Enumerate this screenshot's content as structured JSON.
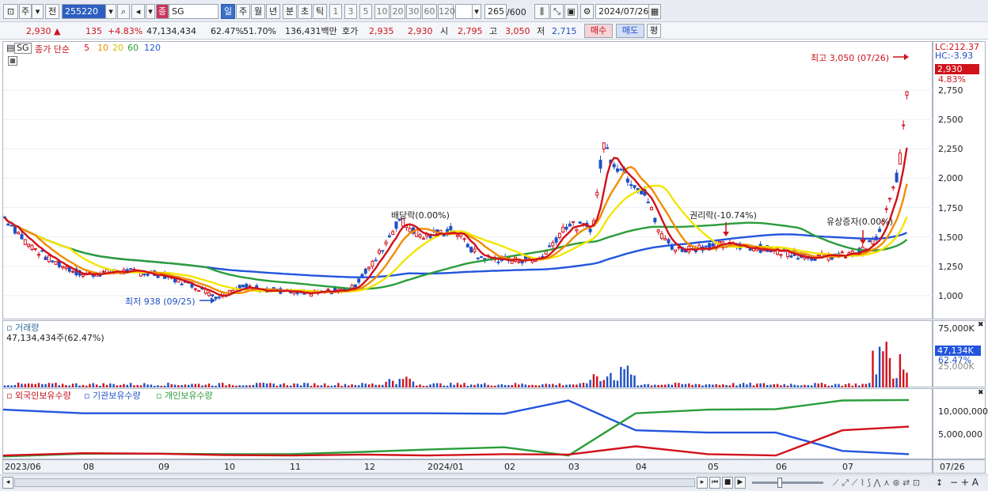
{
  "toolbar": {
    "period_label": "주",
    "prev_label": "전",
    "stock_code": "255220",
    "stock_name": "SG",
    "tf_day": "일",
    "tf_week": "주",
    "tf_month": "월",
    "tf_year": "년",
    "tf_min": "분",
    "tf_sec": "초",
    "tf_tick": "틱",
    "intervals": [
      "1",
      "3",
      "5",
      "10",
      "20",
      "30",
      "60",
      "120"
    ],
    "count": "265",
    "count_total": "/600",
    "date": "2024/07/26",
    "jong_badge": "종"
  },
  "quote": {
    "price": "2,930",
    "change_arrow": "▲",
    "change": "135",
    "change_pct": "+4.83%",
    "volume": "47,134,434",
    "vol_ratio": "62.47%",
    "rate2": "51.70%",
    "amount": "136,431백만",
    "hoga_label": "호가",
    "ask": "2,935",
    "bid": "2,930",
    "open_label": "시",
    "open": "2,795",
    "high_label": "고",
    "high": "3,050",
    "low_label": "저",
    "low": "2,715",
    "buy_label": "매수",
    "sell_label": "매도",
    "eval_label": "평"
  },
  "price_pane": {
    "code_tag": "SG",
    "legend_close": "종가 단순",
    "ma_labels": [
      "5",
      "10",
      "20",
      "60",
      "120"
    ],
    "ma_colors": [
      "#d0121b",
      "#f28c00",
      "#f2e600",
      "#2a9d3a",
      "#2255dd"
    ],
    "annotations": {
      "high": "최고 3,050 (07/26)",
      "low": "최저 938 (09/25)",
      "dividend": "배당락(0.00%)",
      "rights": "권리락(-10.74%)",
      "capital_increase": "유상증자(0.00%)"
    },
    "axis_top_lc": "LC:212.37",
    "axis_top_hc": "HC:-3.93",
    "current_price": "2,930",
    "current_pct": "4.83%",
    "y_ticks": [
      "2,750",
      "2,500",
      "2,250",
      "2,000",
      "1,750",
      "1,500",
      "1,250",
      "1,000"
    ]
  },
  "volume_pane": {
    "title": "거래량",
    "value": "47,134,434주(62.47%)",
    "y_ticks": [
      "75,000K",
      "25,000K"
    ],
    "current": "47,134K",
    "current_pct": "62.47%"
  },
  "holding_pane": {
    "legend": [
      "외국인보유수량",
      "기관보유수량",
      "개인보유수량"
    ],
    "legend_colors": [
      "#d0121b",
      "#2255dd",
      "#2a9d3a"
    ],
    "y_ticks": [
      "10,000,000",
      "5,000,000"
    ]
  },
  "x_axis": {
    "labels": [
      "2023/06",
      "08",
      "09",
      "10",
      "11",
      "12",
      "2024/01",
      "02",
      "03",
      "04",
      "05",
      "06",
      "07"
    ],
    "end_label": "07/26"
  },
  "chart_data": {
    "type": "line",
    "x": [
      "2023/06",
      "08",
      "09",
      "10",
      "11",
      "12",
      "2024/01",
      "02",
      "03",
      "04",
      "05",
      "06",
      "07"
    ],
    "series": [
      {
        "name": "종가",
        "values": [
          1600,
          1200,
          1150,
          1000,
          1050,
          1600,
          1450,
          1300,
          1600,
          2000,
          1400,
          1350,
          1800
        ]
      },
      {
        "name": "외국인보유수량",
        "values": [
          500000,
          1000000,
          900000,
          600000,
          500000,
          700000,
          500000,
          800000,
          700000,
          2500000,
          800000,
          500000,
          6000000
        ]
      },
      {
        "name": "기관보유수량",
        "values": [
          10500000,
          9700000,
          9700000,
          9700000,
          9700000,
          9700000,
          9700000,
          9600000,
          12500000,
          6000000,
          5500000,
          5500000,
          1500000
        ]
      },
      {
        "name": "개인보유수량",
        "values": [
          300000,
          900000,
          900000,
          800000,
          800000,
          1300000,
          1800000,
          2300000,
          500000,
          9700000,
          10500000,
          10600000,
          12500000
        ]
      }
    ],
    "price_high": 3050,
    "price_low": 938,
    "ylim": [
      900,
      3100
    ]
  }
}
